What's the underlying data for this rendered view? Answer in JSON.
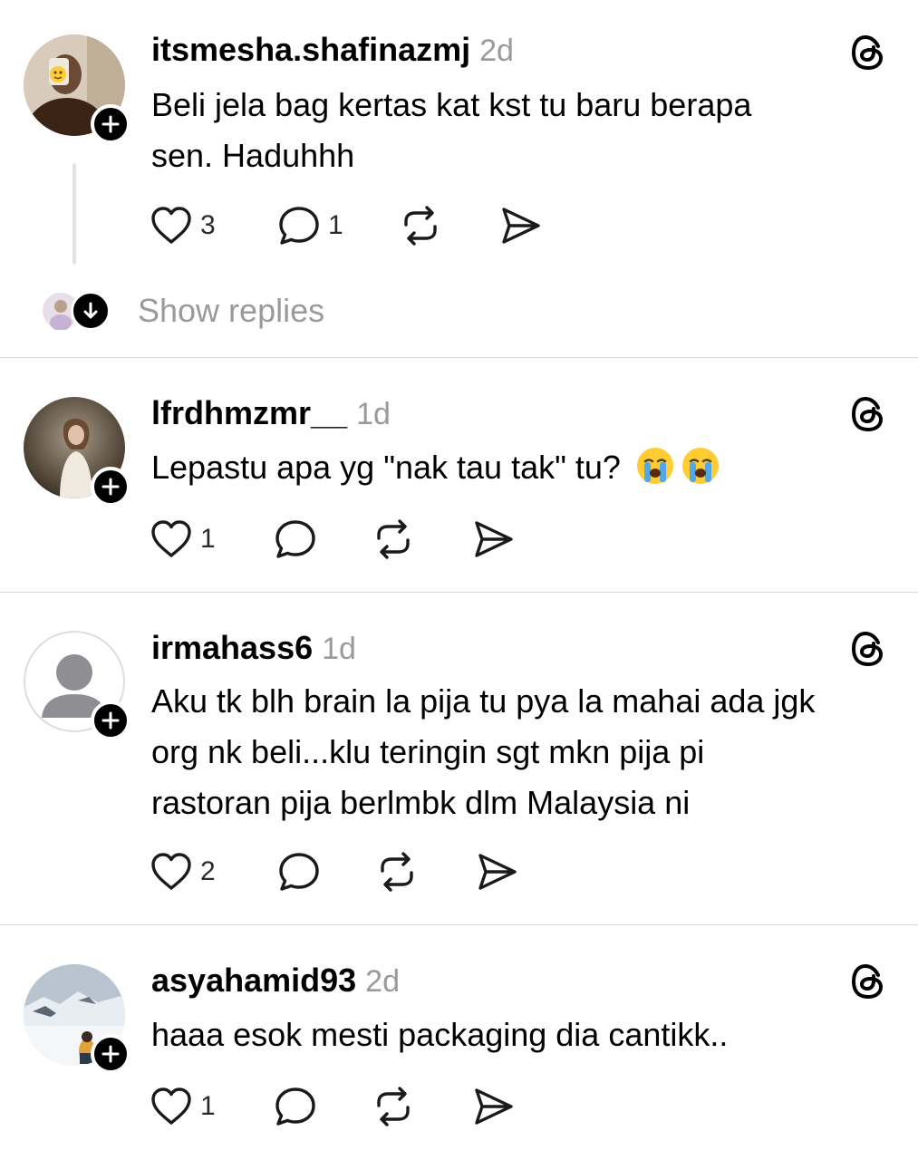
{
  "posts": [
    {
      "username": "itsmesha.shafinazmj",
      "time": "2d",
      "text_lines": [
        "Beli jela bag kertas kat kst tu baru berapa",
        "sen. Haduhhh"
      ],
      "likes": "3",
      "replies": "1",
      "avatar": "mirror-selfie-photo"
    },
    {
      "username": "lfrdhmzmr__",
      "time": "1d",
      "text_lines": [
        "Lepastu apa yg \"nak tau tak\" tu?"
      ],
      "emojis": [
        "loudly-crying-face",
        "loudly-crying-face"
      ],
      "likes": "1",
      "replies": "",
      "avatar": "portrait-photo"
    },
    {
      "username": "irmahass6",
      "time": "1d",
      "text_lines": [
        "Aku tk blh brain la pija tu pya la mahai ada jgk",
        "org nk beli...klu teringin sgt mkn pija pi",
        "rastoran pija berlmbk dlm Malaysia ni"
      ],
      "likes": "2",
      "replies": "",
      "avatar": "default-user-silhouette"
    },
    {
      "username": "asyahamid93",
      "time": "2d",
      "text_lines": [
        "haaa esok mesti packaging dia cantikk.."
      ],
      "likes": "1",
      "replies": "",
      "avatar": "snow-landscape-photo"
    }
  ],
  "show_replies_label": "Show replies",
  "icons": {
    "like": "heart-icon",
    "reply": "comment-bubble-icon",
    "repost": "repost-icon",
    "share": "send-icon",
    "brand": "threads-logo-icon",
    "follow": "plus-icon",
    "expand": "arrow-down-icon"
  },
  "colors": {
    "text": "#000000",
    "muted": "#9a9a9a",
    "divider": "#d9d9d9",
    "icon": "#1a1a1a"
  }
}
